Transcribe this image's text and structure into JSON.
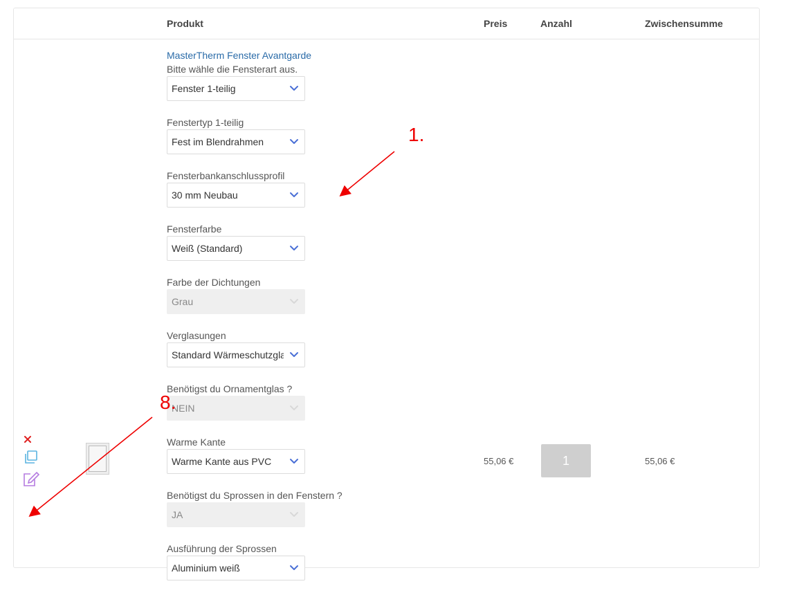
{
  "table": {
    "headers": {
      "product": "Produkt",
      "price": "Preis",
      "quantity": "Anzahl",
      "subtotal": "Zwischensumme"
    }
  },
  "item": {
    "name": "MasterTherm Fenster Avantgarde",
    "intro_label": "Bitte wähle die Fensterart aus.",
    "fields": [
      {
        "label": "",
        "value": "Fenster 1-teilig",
        "disabled": false
      },
      {
        "label": "Fenstertyp 1-teilig",
        "value": "Fest im Blendrahmen",
        "disabled": false
      },
      {
        "label": "Fensterbankanschlussprofil",
        "value": "30 mm Neubau",
        "disabled": false
      },
      {
        "label": "Fensterfarbe",
        "value": "Weiß (Standard)",
        "disabled": false
      },
      {
        "label": "Farbe der Dichtungen",
        "value": "Grau",
        "disabled": true
      },
      {
        "label": "Verglasungen",
        "value": "Standard Wärmeschutzglas",
        "disabled": false
      },
      {
        "label": "Benötigst du Ornamentglas ?",
        "value": "NEIN",
        "disabled": true
      },
      {
        "label": "Warme Kante",
        "value": "Warme Kante aus PVC",
        "disabled": false
      },
      {
        "label": "Benötigst du Sprossen in den Fenstern ?",
        "value": "JA",
        "disabled": true
      },
      {
        "label": "Ausführung der Sprossen",
        "value": "Aluminium weiß",
        "disabled": false
      }
    ],
    "price": "55,06 €",
    "quantity": "1",
    "subtotal": "55,06 €"
  },
  "icons": {
    "remove": "close-icon",
    "copy": "copy-icon",
    "edit": "edit-icon",
    "chevron": "chevron-down-icon"
  },
  "annotations": {
    "first": "1.",
    "second": "8."
  },
  "colors": {
    "link": "#2a6ba8",
    "chevron": "#4a6fd6",
    "remove": "#e02020",
    "copy": "#5ab4e0",
    "edit": "#b57be0",
    "annotation": "#ee0000"
  }
}
